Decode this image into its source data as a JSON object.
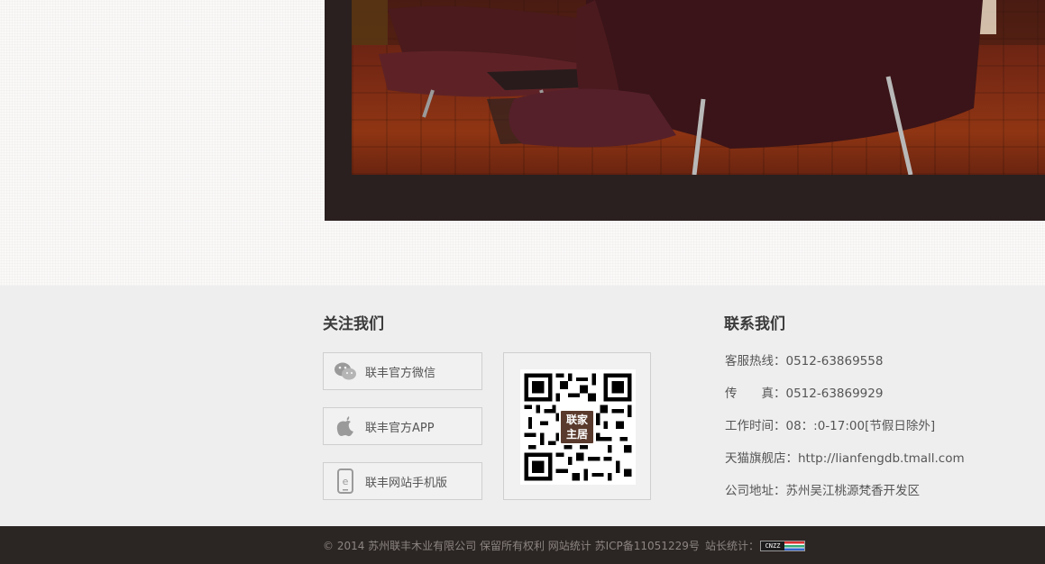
{
  "follow": {
    "title": "关注我们",
    "buttons": [
      {
        "label": "联丰官方微信",
        "icon": "wechat-icon"
      },
      {
        "label": "联丰官方APP",
        "icon": "apple-icon"
      },
      {
        "label": "联丰网站手机版",
        "icon": "mobile-icon"
      }
    ],
    "qr_badge": [
      "联家",
      "主居"
    ]
  },
  "contact": {
    "title": "联系我们",
    "lines": [
      "客服热线：0512-63869558",
      "传　　真：0512-63869929",
      "工作时间：08：:0-17:00[节假日除外]",
      "天猫旗舰店：http://lianfengdb.tmall.com",
      "公司地址：苏州吴江桃源梵香开发区"
    ]
  },
  "footer": {
    "copyright": "© 2014 苏州联丰木业有限公司 保留所有权利 网站统计 苏ICP备11051229号",
    "stats_label": "站长统计：",
    "stats_badge": "CNZZ"
  },
  "colors": {
    "dark_bar": "#2b2523",
    "hero_frame": "#2a201f",
    "footer_bg": "#eeeeee"
  }
}
